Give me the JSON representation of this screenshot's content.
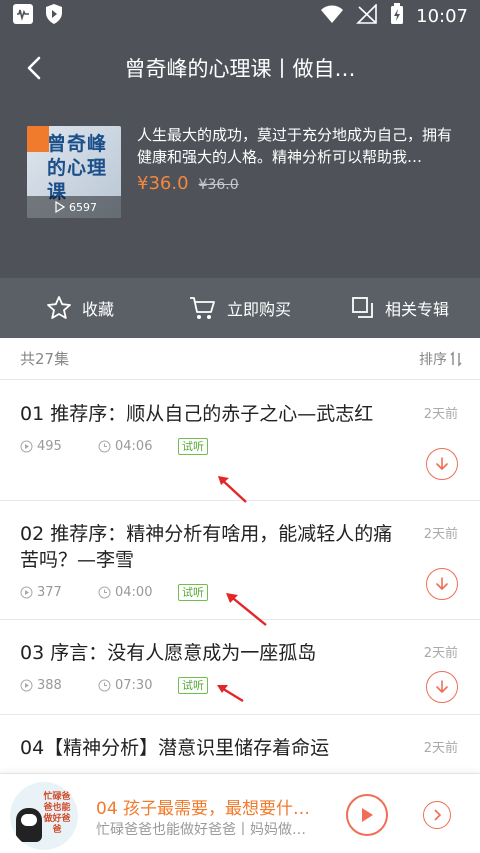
{
  "status_bar": {
    "time": "10:07"
  },
  "header": {
    "title": "曾奇峰的心理课丨做自…"
  },
  "album": {
    "cover_title": "曾奇峰的心理课",
    "play_count": "6597",
    "description": "人生最大的成功，莫过于充分地成为自己，拥有健康和强大的人格。精神分析可以帮助我…",
    "price": "¥36.0",
    "original_price": "¥36.0"
  },
  "actions": {
    "collect": "收藏",
    "buy": "立即购买",
    "related": "相关专辑"
  },
  "list_header": {
    "count": "共27集",
    "sort": "排序"
  },
  "episodes": [
    {
      "title": "01 推荐序：顺从自己的赤子之心—武志红",
      "date": "2天前",
      "plays": "495",
      "duration": "04:06",
      "tag": "试听"
    },
    {
      "title": "02 推荐序：精神分析有啥用，能减轻人的痛苦吗？—李雪",
      "date": "2天前",
      "plays": "377",
      "duration": "04:00",
      "tag": "试听"
    },
    {
      "title": "03 序言：没有人愿意成为一座孤岛",
      "date": "2天前",
      "plays": "388",
      "duration": "07:30",
      "tag": "试听"
    },
    {
      "title": "04【精神分析】潜意识里储存着命运",
      "date": "2天前"
    }
  ],
  "player": {
    "cover_text": "忙碌爸爸也能做好爸爸",
    "title": "04 孩子最需要，最想要什…",
    "subtitle": "忙碌爸爸也能做好爸爸丨妈妈做…"
  },
  "colors": {
    "accent": "#ef6e55",
    "price": "#f3873f",
    "trial": "#55a833",
    "header_bg": "#4f5359"
  }
}
